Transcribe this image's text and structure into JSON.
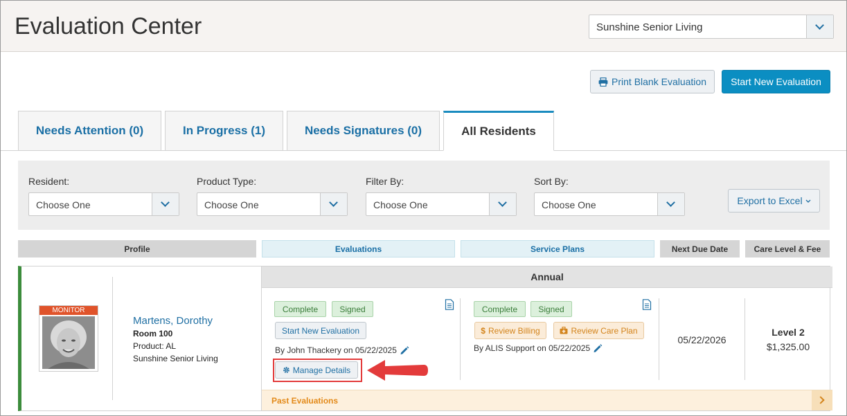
{
  "header": {
    "title": "Evaluation Center",
    "community": "Sunshine Senior Living"
  },
  "actions": {
    "print_label": "Print Blank Evaluation",
    "start_label": "Start New Evaluation"
  },
  "tabs": [
    {
      "label": "Needs Attention (0)"
    },
    {
      "label": "In Progress (1)"
    },
    {
      "label": "Needs Signatures (0)"
    },
    {
      "label": "All Residents",
      "active": true
    }
  ],
  "filters": {
    "resident": {
      "label": "Resident:",
      "value": "Choose One"
    },
    "product_type": {
      "label": "Product Type:",
      "value": "Choose One"
    },
    "filter_by": {
      "label": "Filter By:",
      "value": "Choose One"
    },
    "sort_by": {
      "label": "Sort By:",
      "value": "Choose One"
    },
    "export_label": "Export to Excel"
  },
  "columns": {
    "profile": "Profile",
    "evaluations": "Evaluations",
    "service_plans": "Service Plans",
    "next_due": "Next Due Date",
    "care_level": "Care Level & Fee"
  },
  "resident": {
    "tag": "MONITOR",
    "name": "Martens, Dorothy",
    "room": "Room 100",
    "product": "Product: AL",
    "community": "Sunshine Senior Living",
    "section": "Annual",
    "evaluation": {
      "status": "Complete",
      "signed": "Signed",
      "start_label": "Start New Evaluation",
      "by": "By John Thackery on 05/22/2025",
      "manage_label": "Manage Details"
    },
    "service_plan": {
      "status": "Complete",
      "signed": "Signed",
      "billing_label": "Review Billing",
      "care_plan_label": "Review Care Plan",
      "by": "By ALIS Support on 05/22/2025"
    },
    "next_due": "05/22/2026",
    "level": "Level 2",
    "fee": "$1,325.00",
    "past_label": "Past Evaluations"
  },
  "colors": {
    "accent": "#0b8ec2",
    "link": "#1f6fa3",
    "status_green": "#3c8c3c",
    "highlight_red": "#e33b3b",
    "past_orange": "#e38a1a"
  }
}
